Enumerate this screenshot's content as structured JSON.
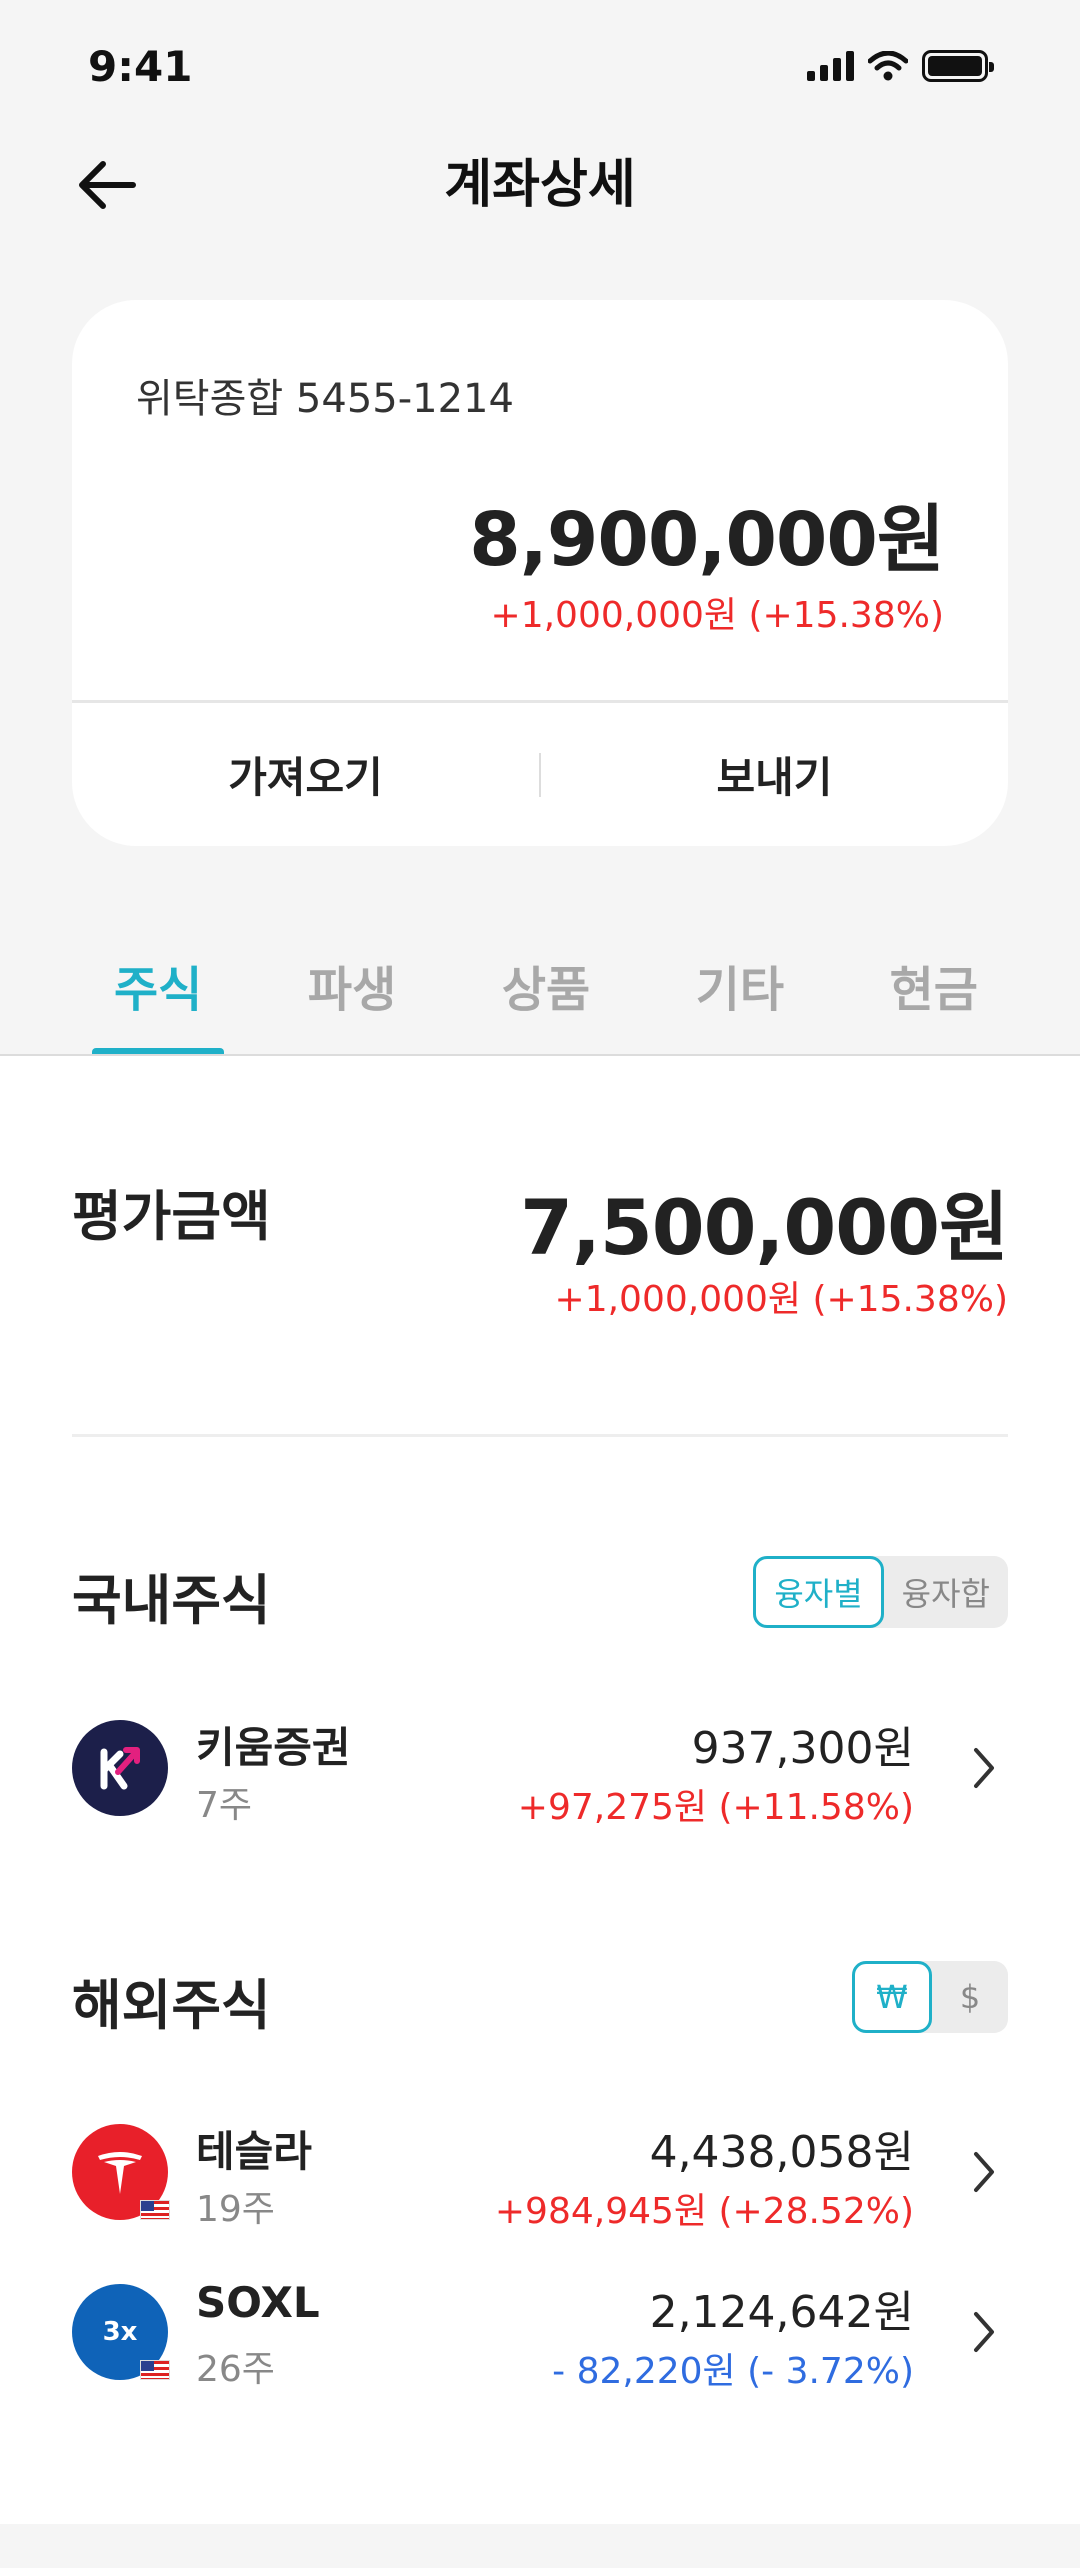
{
  "status_bar": {
    "time": "9:41"
  },
  "header": {
    "title": "계좌상세"
  },
  "account": {
    "name": "위탁종합 5455-1214",
    "total": "8,900,000원",
    "change": "+1,000,000원 (+15.38%)",
    "actions": [
      "가져오기",
      "보내기"
    ]
  },
  "tabs": [
    {
      "label": "주식",
      "active": true
    },
    {
      "label": "파생",
      "active": false
    },
    {
      "label": "상품",
      "active": false
    },
    {
      "label": "기타",
      "active": false
    },
    {
      "label": "현금",
      "active": false
    }
  ],
  "evaluation": {
    "label": "평가금액",
    "total": "7,500,000원",
    "change": "+1,000,000원 (+15.38%)"
  },
  "domestic": {
    "title": "국내주식",
    "toggle": [
      "융자별",
      "융자합"
    ],
    "stocks": [
      {
        "name": "키움증권",
        "qty": "7주",
        "value": "937,300원",
        "change": "+97,275원 (+11.58%)",
        "direction": "up",
        "logo": "kiwoom-logo-icon",
        "logo_color": "#1c1f4a"
      }
    ]
  },
  "overseas": {
    "title": "해외주식",
    "toggle": [
      "₩",
      "$"
    ],
    "stocks": [
      {
        "name": "테슬라",
        "qty": "19주",
        "value": "4,438,058원",
        "change": "+984,945원 (+28.52%)",
        "direction": "up",
        "logo": "tesla-logo-icon",
        "logo_color": "#e8202a"
      },
      {
        "name": "SOXL",
        "qty": "26주",
        "value": "2,124,642원",
        "change": "- 82,220원 (- 3.72%)",
        "direction": "down",
        "logo": "soxl-logo-icon",
        "logo_color": "#0f63b8",
        "logo_text": "3x"
      }
    ]
  },
  "colors": {
    "accent": "#1fb0c8",
    "up": "#ee2a2a",
    "down": "#2f6ce0"
  }
}
